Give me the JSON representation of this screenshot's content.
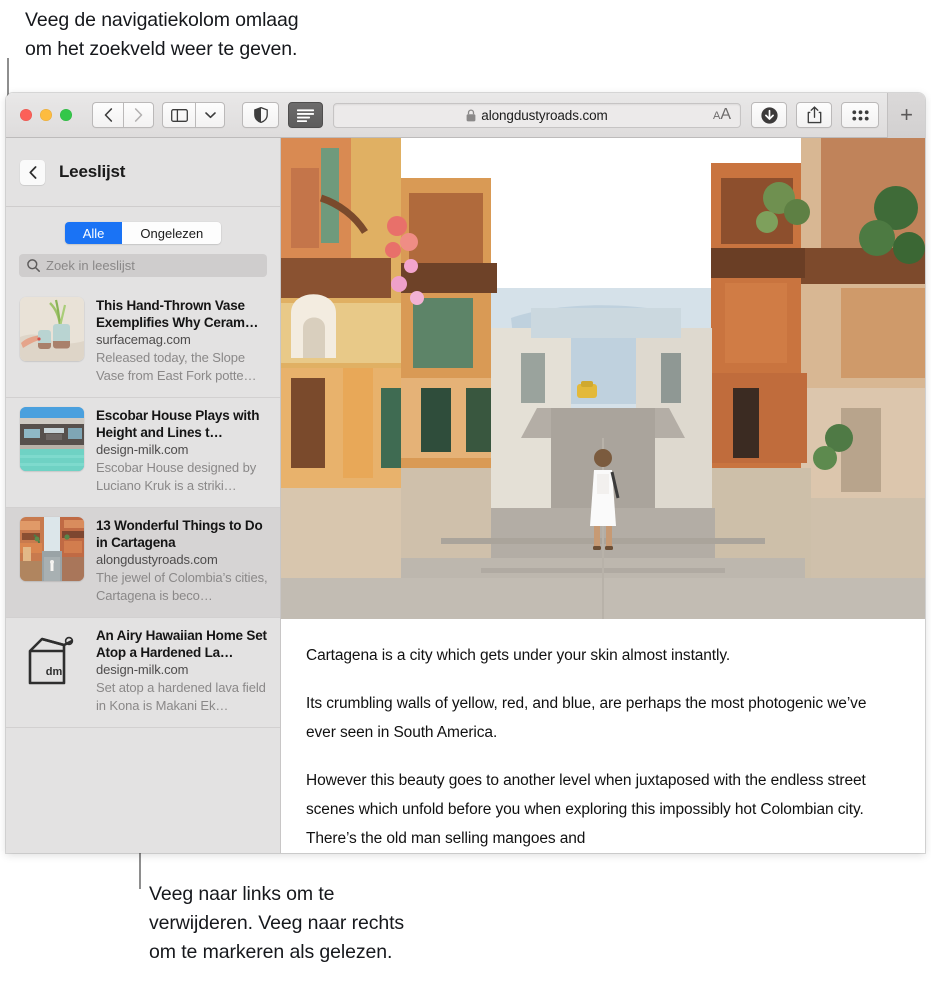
{
  "callouts": {
    "top": "Veeg de navigatiekolom omlaag\nom het zoekveld weer te geven.",
    "bottom": "Veeg naar links om te\nverwijderen. Veeg naar rechts\nom te markeren als gelezen."
  },
  "toolbar": {
    "back_icon": "back-chevron-icon",
    "forward_icon": "forward-chevron-icon",
    "sidebar_icon": "sidebar-toggle-icon",
    "sidebar_menu_icon": "chevron-down-icon",
    "privacy_icon": "shield-icon",
    "reader_icon": "reader-view-icon",
    "lock_icon": "lock-icon",
    "url": "alongdustyroads.com",
    "text_size_small": "A",
    "text_size_large": "A",
    "download_icon": "download-icon",
    "share_icon": "share-icon",
    "tab_overview_icon": "tab-overview-icon",
    "new_tab_label": "+"
  },
  "sidebar": {
    "back_icon": "back-chevron-icon",
    "title": "Leeslijst",
    "filters": [
      {
        "label": "Alle",
        "selected": true
      },
      {
        "label": "Ongelezen",
        "selected": false
      }
    ],
    "search": {
      "icon": "search-icon",
      "placeholder": "Zoek in leeslijst",
      "value": ""
    },
    "items": [
      {
        "title": "This Hand-Thrown Vase Exemplifies Why Ceram…",
        "site": "surfacemag.com",
        "snippet": "Released today, the Slope Vase from East Fork potte…",
        "thumb": "ceramic-vases-thumbnail",
        "selected": false
      },
      {
        "title": "Escobar House Plays with Height and Lines t…",
        "site": "design-milk.com",
        "snippet": "Escobar House designed by Luciano Kruk is a striki…",
        "thumb": "modern-house-pool-thumbnail",
        "selected": false
      },
      {
        "title": "13 Wonderful Things to Do in Cartagena",
        "site": "alongdustyroads.com",
        "snippet": "The jewel of Colombia’s cities, Cartagena is beco…",
        "thumb": "cartagena-street-thumbnail",
        "selected": true
      },
      {
        "title": "An Airy Hawaiian Home Set Atop a Hardened La…",
        "site": "design-milk.com",
        "snippet": "Set atop a hardened lava field in Kona is Makani Ek…",
        "thumb": "design-milk-logo-thumbnail",
        "thumb_label": "dm",
        "selected": false
      }
    ]
  },
  "content": {
    "hero_alt": "cartagena-street-photo",
    "paragraphs": [
      "Cartagena is a city which gets under your skin almost instantly.",
      "Its crumbling walls of yellow, red, and blue, are perhaps the most photogenic we’ve ever seen in South America.",
      "However this beauty goes to another level when juxtaposed with the endless street scenes which unfold before you when exploring this impossibly hot Colombian city. There’s the old man selling mangoes and"
    ]
  },
  "colors": {
    "accent_blue": "#1a73f5",
    "toolbar_bg": "#e3e1e1",
    "sidebar_bg": "#e3e2e2",
    "selected_row": "#d6d4d4",
    "close": "#fc6058",
    "minimize": "#fdbc40",
    "maximize": "#34c749"
  }
}
